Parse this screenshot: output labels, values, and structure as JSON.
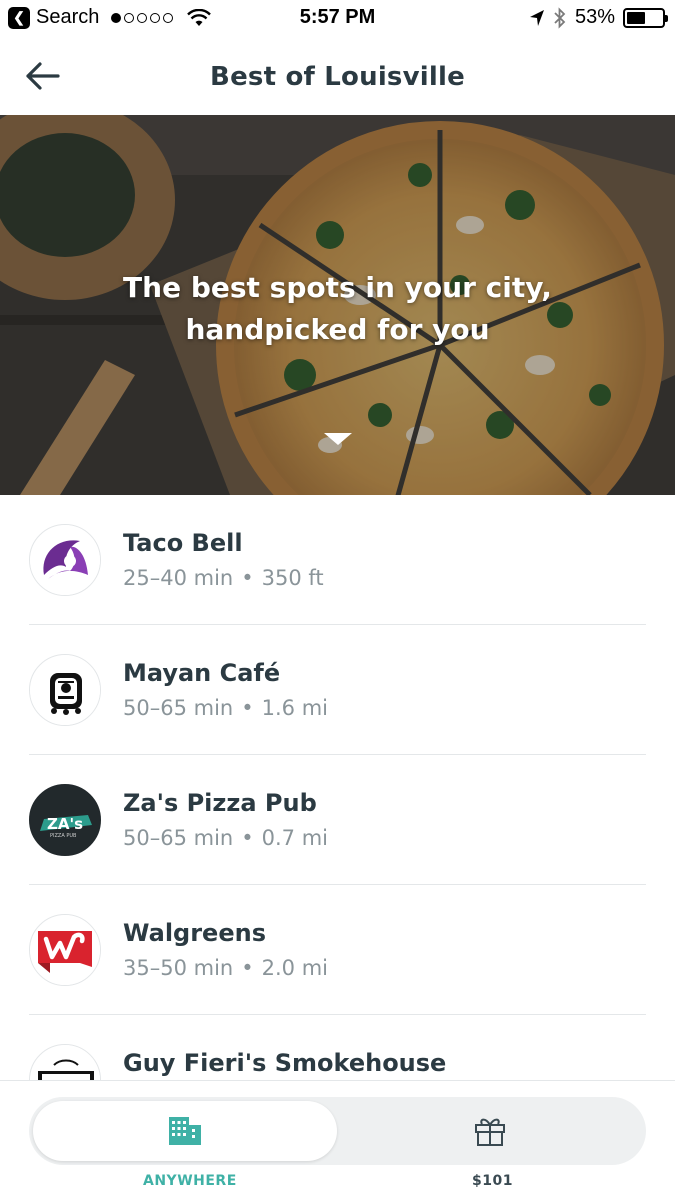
{
  "status_bar": {
    "back_app_label": "Search",
    "time": "5:57 PM",
    "battery_percent": "53%",
    "battery_level": 0.53,
    "signal_bars_filled": 1,
    "signal_bars_total": 5
  },
  "nav": {
    "title": "Best of Louisville"
  },
  "hero": {
    "line1": "The best spots in your city,",
    "line2": "handpicked for you"
  },
  "stores": [
    {
      "name": "Taco Bell",
      "time": "25–40 min",
      "distance": "350 ft",
      "logo": "taco-bell-logo"
    },
    {
      "name": "Mayan Café",
      "time": "50–65 min",
      "distance": "1.6 mi",
      "logo": "mayan-cafe-logo"
    },
    {
      "name": "Za's Pizza Pub",
      "time": "50–65 min",
      "distance": "0.7 mi",
      "logo": "zas-pizza-pub-logo",
      "logo_text": "ZA's",
      "logo_subtext": "PIZZA PUB"
    },
    {
      "name": "Walgreens",
      "time": "35–50 min",
      "distance": "2.0 mi",
      "logo": "walgreens-logo"
    },
    {
      "name": "Guy Fieri's Smokehouse",
      "time": "",
      "distance": "",
      "logo": "guy-fieris-smokehouse-logo"
    }
  ],
  "separator": "•",
  "tabs": [
    {
      "label": "ANYWHERE",
      "icon": "building-icon",
      "active": true
    },
    {
      "label": "$101",
      "icon": "gift-icon",
      "active": false
    }
  ],
  "colors": {
    "accent": "#3fb1a6",
    "title": "#2b3a42",
    "meta": "#8a9499"
  }
}
